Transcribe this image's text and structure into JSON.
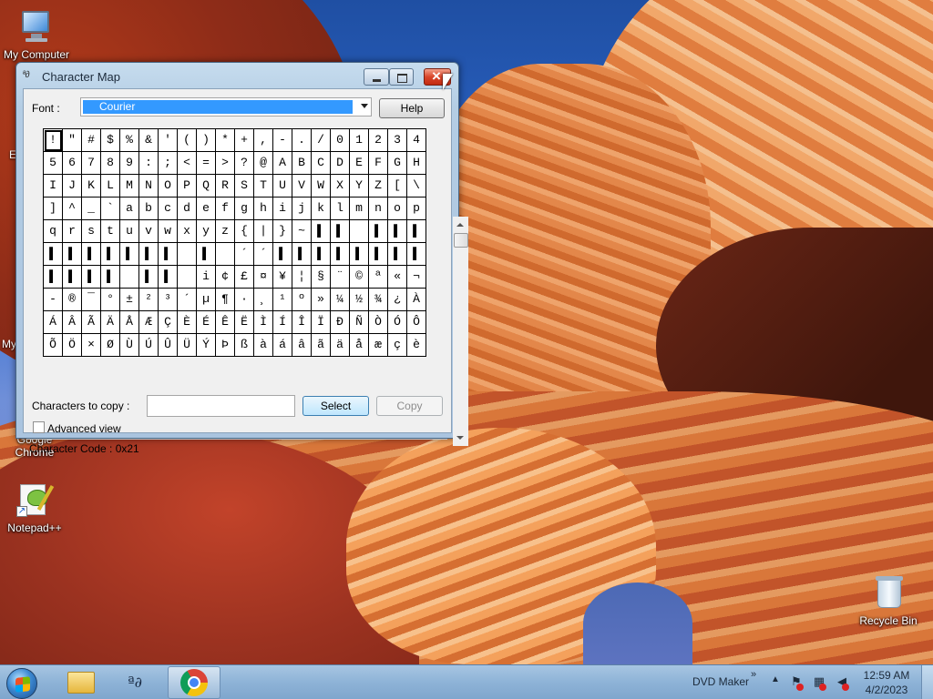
{
  "desktop": {
    "icons": {
      "my_computer": "My Computer",
      "google_chrome": "Google Chrome",
      "notepad_pp": "Notepad++",
      "recycle_bin": "Recycle Bin"
    },
    "partial_labels": {
      "left_e": "E",
      "left_my": "My"
    }
  },
  "window": {
    "title": "Character Map",
    "font_label": "Font :",
    "font_value": "Courier",
    "help_label": "Help",
    "chars_to_copy_label": "Characters to copy :",
    "chars_to_copy_value": "",
    "select_label": "Select",
    "copy_label": "Copy",
    "advanced_view_label": "Advanced view",
    "advanced_view_checked": false,
    "status_text": "Character Code : 0x21",
    "selected_index": 0,
    "chars": [
      "!",
      "\"",
      "#",
      "$",
      "%",
      "&",
      "'",
      "(",
      ")",
      "*",
      "+",
      ",",
      "-",
      ".",
      "/",
      "0",
      "1",
      "2",
      "3",
      "4",
      "5",
      "6",
      "7",
      "8",
      "9",
      ":",
      ";",
      "<",
      "=",
      ">",
      "?",
      "@",
      "A",
      "B",
      "C",
      "D",
      "E",
      "F",
      "G",
      "H",
      "I",
      "J",
      "K",
      "L",
      "M",
      "N",
      "O",
      "P",
      "Q",
      "R",
      "S",
      "T",
      "U",
      "V",
      "W",
      "X",
      "Y",
      "Z",
      "[",
      "\\",
      "]",
      "^",
      "_",
      "`",
      "a",
      "b",
      "c",
      "d",
      "e",
      "f",
      "g",
      "h",
      "i",
      "j",
      "k",
      "l",
      "m",
      "n",
      "o",
      "p",
      "q",
      "r",
      "s",
      "t",
      "u",
      "v",
      "w",
      "x",
      "y",
      "z",
      "{",
      "|",
      "}",
      "~",
      "▌",
      "▌",
      "",
      "▌",
      "▌",
      "▌",
      "▌",
      "▌",
      "▌",
      "▌",
      "▌",
      "▌",
      "▌",
      "",
      "▌",
      "",
      "´",
      "´",
      "▌",
      "▌",
      "▌",
      "▌",
      "▌",
      "▌",
      "▌",
      "▌",
      "▌",
      "▌",
      "▌",
      "▌",
      "",
      "▌",
      "▌",
      "",
      "i",
      "¢",
      "£",
      "¤",
      "¥",
      "¦",
      "§",
      "¨",
      "©",
      "ª",
      "«",
      "¬",
      "-",
      "®",
      "¯",
      "°",
      "±",
      "²",
      "³",
      "´",
      "µ",
      "¶",
      "·",
      "¸",
      "¹",
      "º",
      "»",
      "¼",
      "½",
      "¾",
      "¿",
      "À",
      "Á",
      "Â",
      "Ã",
      "Ä",
      "Å",
      "Æ",
      "Ç",
      "È",
      "É",
      "Ê",
      "Ë",
      "Ì",
      "Í",
      "Î",
      "Ï",
      "Ð",
      "Ñ",
      "Ò",
      "Ó",
      "Ô",
      "Õ",
      "Ö",
      "×",
      "Ø",
      "Ù",
      "Ú",
      "Û",
      "Ü",
      "Ý",
      "Þ",
      "ß",
      "à",
      "á",
      "â",
      "ã",
      "ä",
      "å",
      "æ",
      "ç",
      "è"
    ]
  },
  "taskbar": {
    "dvd_maker": "DVD Maker",
    "chevron": "»",
    "tray_up": "▲",
    "time": "12:59 AM",
    "date": "4/2/2023"
  },
  "colors": {
    "selection": "#3399ff",
    "close_button": "#c22a10",
    "taskbar": "#8eb3d7"
  }
}
